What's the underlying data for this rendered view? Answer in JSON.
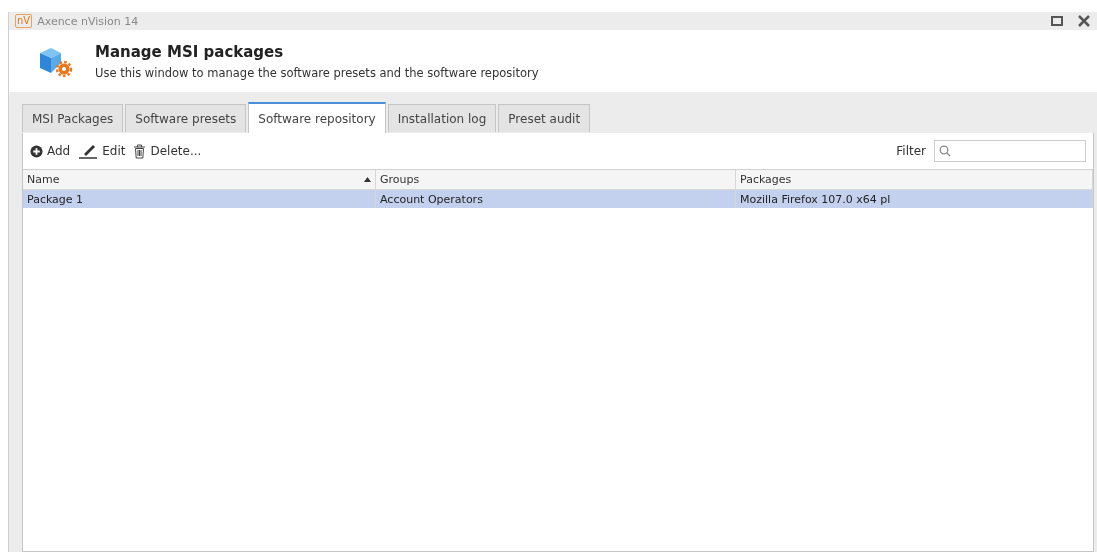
{
  "window": {
    "logo": "nV",
    "title": "Axence nVision 14"
  },
  "header": {
    "title": "Manage MSI packages",
    "subtitle": "Use this window to manage the software presets and the software repository"
  },
  "tabs": [
    {
      "label": "MSI Packages",
      "selected": false
    },
    {
      "label": "Software presets",
      "selected": false
    },
    {
      "label": "Software repository",
      "selected": true
    },
    {
      "label": "Installation log",
      "selected": false
    },
    {
      "label": "Preset audit",
      "selected": false
    }
  ],
  "toolbar": [
    {
      "kind": "add",
      "label": "Add"
    },
    {
      "kind": "edit",
      "label": "Edit"
    },
    {
      "kind": "delete",
      "label": "Delete..."
    }
  ],
  "filter": {
    "label": "Filter"
  },
  "table": {
    "columns": [
      {
        "label": "Name",
        "sorted": true
      },
      {
        "label": "Groups",
        "sorted": false
      },
      {
        "label": "Packages",
        "sorted": false
      }
    ],
    "rows": [
      {
        "cells": [
          "Package 1",
          "Account Operators",
          "Mozilla Firefox 107.0 x64 pl"
        ],
        "selected": true
      }
    ]
  }
}
